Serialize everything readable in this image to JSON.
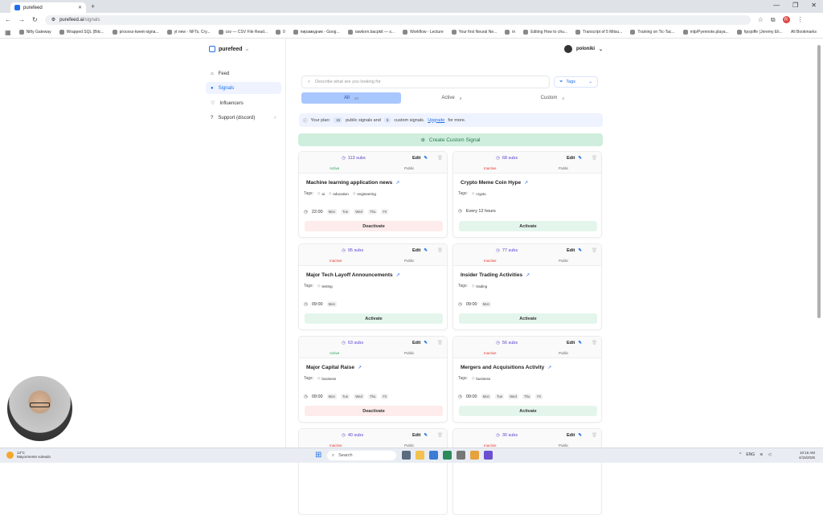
{
  "browser": {
    "tab_title": "purefeed",
    "url_host": "purefeed.ai",
    "url_path": "/signals",
    "bookmarks": [
      "Nifty Gateway",
      "Wrapped SQL (Bitc...",
      "process-tweet-signa...",
      "yt new - NFTs, Cry...",
      "csv — CSV File Read...",
      "0",
      "пирамидник - Goog...",
      "rawkorn.bacpkit — s...",
      "Workflow - Lecture",
      "Your first Neural Ne...",
      "in",
      "Editing How to chu...",
      "Transcript of 5 Mitsu...",
      "Training on Tic-Tac...",
      "mlp/Pyennote.playa...",
      "hpsjoffe (Jeremy Eli..."
    ],
    "all_bookmarks": "All Bookmarks",
    "profile_initial": "R"
  },
  "app": {
    "logo": "purefeed",
    "logo_suffix": "ai",
    "user": "poloniki",
    "nav": [
      {
        "label": "Feed"
      },
      {
        "label": "Signals"
      },
      {
        "label": "Influencers"
      },
      {
        "label": "Support (discord)"
      }
    ],
    "search_placeholder": "Describe what are you looking for",
    "tags_button": "Tags",
    "filters": [
      {
        "label": "All",
        "count": "23"
      },
      {
        "label": "Active",
        "count": "3"
      },
      {
        "label": "Custom",
        "count": "4"
      }
    ],
    "plan": {
      "prefix": "Your plan:",
      "public_count": "15",
      "public_text": "public signals and",
      "custom_count": "5",
      "custom_text": "custom signals.",
      "upgrade": "Upgrade",
      "suffix": "for more."
    },
    "create_button": "Create Custom Signal"
  },
  "labels": {
    "edit": "Edit",
    "tags": "Tags:",
    "public": "Public",
    "active": "Active",
    "inactive": "Inactive",
    "activate": "Activate",
    "deactivate": "Deactivate"
  },
  "cards": [
    {
      "subs": "113 subs",
      "status": "Active",
      "title": "Machine learning application news",
      "tags": [
        "ai",
        "education",
        "engineering"
      ],
      "time": "22:00",
      "days": [
        "Mon",
        "Tue",
        "Wed",
        "Thu",
        "Fri"
      ],
      "action": "Deactivate"
    },
    {
      "subs": "68 subs",
      "status": "Inactive",
      "title": "Crypto Meme Coin Hype",
      "tags": [
        "crypto"
      ],
      "time": "Every 12 hours",
      "days": [],
      "action": "Activate"
    },
    {
      "subs": "95 subs",
      "status": "Inactive",
      "title": "Major Tech Layoff Announcements",
      "tags": [
        "testing"
      ],
      "time": "09:00",
      "days": [
        "Mon"
      ],
      "action": "Activate"
    },
    {
      "subs": "77 subs",
      "status": "Inactive",
      "title": "Insider Trading Activities",
      "tags": [
        "trading"
      ],
      "time": "09:00",
      "days": [
        "Mon"
      ],
      "action": "Activate"
    },
    {
      "subs": "63 subs",
      "status": "Active",
      "title": "Major Capital Raise",
      "tags": [
        "business"
      ],
      "time": "09:00",
      "days": [
        "Mon",
        "Tue",
        "Wed",
        "Thu",
        "Fri"
      ],
      "action": "Deactivate"
    },
    {
      "subs": "56 subs",
      "status": "Inactive",
      "title": "Mergers and Acquisitions Activity",
      "tags": [
        "business"
      ],
      "time": "09:00",
      "days": [
        "Mon",
        "Tue",
        "Wed",
        "Thu",
        "Fri"
      ],
      "action": "Activate"
    },
    {
      "subs": "40 subs",
      "status": "Inactive",
      "title": "",
      "tags": [],
      "time": "",
      "days": [],
      "action": ""
    },
    {
      "subs": "30 subs",
      "status": "Inactive",
      "title": "",
      "tags": [],
      "time": "",
      "days": [],
      "action": ""
    }
  ],
  "taskbar": {
    "weather_temp": "13°C",
    "weather_desc": "Mayormente soleado",
    "search": "Search",
    "lang": "ENG",
    "time": "10:16 AM",
    "date": "4/15/2025"
  },
  "colors": {
    "accent": "#1f6feb",
    "active_status": "#22a35a",
    "inactive_status": "#e0382d",
    "create_bg": "#cfeedd"
  }
}
